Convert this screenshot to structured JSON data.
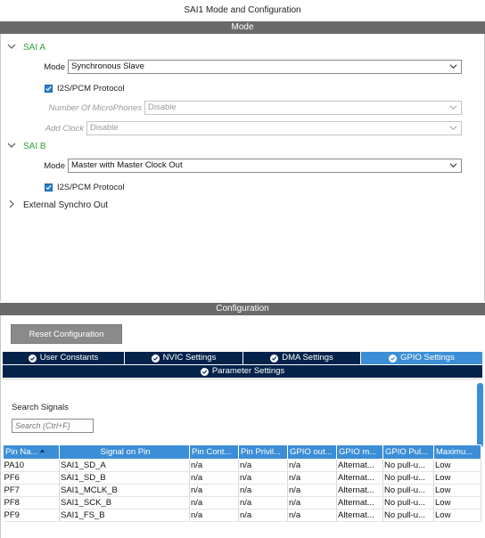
{
  "window": {
    "title": "SAI1 Mode and Configuration"
  },
  "mode_bar": {
    "label": "Mode"
  },
  "sai_a": {
    "label": "SAI A",
    "mode_label": "Mode",
    "mode_value": "Synchronous Slave",
    "protocol_label": "I2S/PCM Protocol",
    "protocol_checked": true,
    "mic_label": "Number Of MicroPhones",
    "mic_value": "Disable",
    "clock_label": "Add Clock",
    "clock_value": "Disable"
  },
  "sai_b": {
    "label": "SAI B",
    "mode_label": "Mode",
    "mode_value": "Master with Master Clock Out",
    "protocol_label": "I2S/PCM Protocol",
    "protocol_checked": true
  },
  "external_synchro": {
    "label": "External Synchro Out"
  },
  "config_bar": {
    "label": "Configuration"
  },
  "reset_button": {
    "label": "Reset Configuration"
  },
  "tabs": [
    {
      "label": "User Constants",
      "active": false
    },
    {
      "label": "NVIC Settings",
      "active": false
    },
    {
      "label": "DMA Settings",
      "active": false
    },
    {
      "label": "GPIO Settings",
      "active": true
    },
    {
      "label": "Parameter Settings",
      "active": false
    }
  ],
  "search": {
    "label": "Search Signals",
    "placeholder": "Search (Ctrl+F)"
  },
  "table": {
    "headers": [
      "Pin Na...",
      "Signal on Pin",
      "Pin Cont...",
      "Pin Privil...",
      "GPIO out...",
      "GPIO m...",
      "GPIO Pul...",
      "Maximu..."
    ],
    "rows": [
      [
        "PA10",
        "SAI1_SD_A",
        "n/a",
        "n/a",
        "n/a",
        "Alternat...",
        "No pull-u...",
        "Low"
      ],
      [
        "PF6",
        "SAI1_SD_B",
        "n/a",
        "n/a",
        "n/a",
        "Alternat...",
        "No pull-u...",
        "Low"
      ],
      [
        "PF7",
        "SAI1_MCLK_B",
        "n/a",
        "n/a",
        "n/a",
        "Alternat...",
        "No pull-u...",
        "Low"
      ],
      [
        "PF8",
        "SAI1_SCK_B",
        "n/a",
        "n/a",
        "n/a",
        "Alternat...",
        "No pull-u...",
        "Low"
      ],
      [
        "PF9",
        "SAI1_FS_B",
        "n/a",
        "n/a",
        "n/a",
        "Alternat...",
        "No pull-u...",
        "Low"
      ]
    ]
  },
  "colors": {
    "tab_dark": "#03234b",
    "tab_active": "#3c8ed6",
    "tree_green": "#2e9e3e",
    "bar_gray": "#6a6a6a"
  },
  "icons": {
    "expand": "chevron-down-icon",
    "collapse": "chevron-right-icon",
    "tab_ok": "check-circle-icon",
    "sort": "sort-icon"
  }
}
